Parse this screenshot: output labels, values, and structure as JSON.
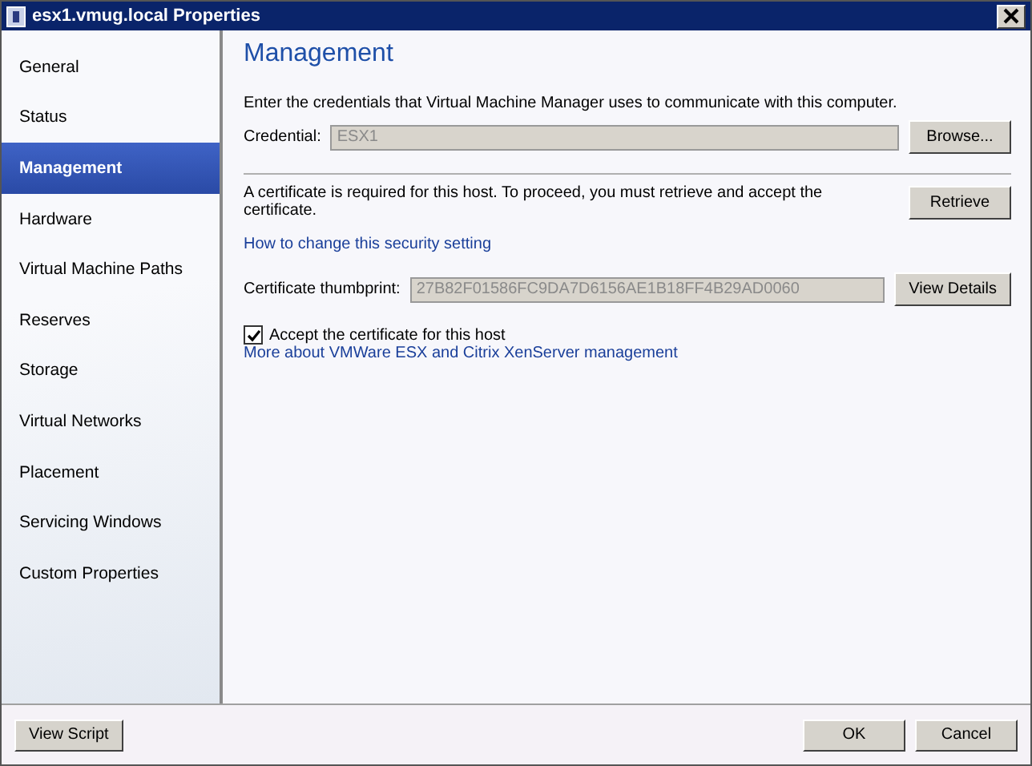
{
  "window": {
    "title": "esx1.vmug.local Properties"
  },
  "sidebar": {
    "items": [
      {
        "label": "General",
        "selected": false
      },
      {
        "label": "Status",
        "selected": false
      },
      {
        "label": "Management",
        "selected": true
      },
      {
        "label": "Hardware",
        "selected": false
      },
      {
        "label": "Virtual Machine Paths",
        "selected": false
      },
      {
        "label": "Reserves",
        "selected": false
      },
      {
        "label": "Storage",
        "selected": false
      },
      {
        "label": "Virtual Networks",
        "selected": false
      },
      {
        "label": "Placement",
        "selected": false
      },
      {
        "label": "Servicing Windows",
        "selected": false
      },
      {
        "label": "Custom Properties",
        "selected": false
      }
    ]
  },
  "content": {
    "heading": "Management",
    "credentials_text": "Enter the credentials that Virtual Machine Manager uses to communicate with this computer.",
    "credential": {
      "label": "Credential:",
      "value": "ESX1",
      "disabled": true
    },
    "browse_button": "Browse...",
    "certificate_text": "A certificate is required for this host. To proceed, you must retrieve and accept the certificate.",
    "retrieve_button": "Retrieve",
    "security_link": "How to change this security setting",
    "thumbprint": {
      "label": "Certificate thumbprint:",
      "value": "27B82F01586FC9DA7D6156AE1B18FF4B29AD0060",
      "disabled": true
    },
    "view_details_button": "View Details",
    "accept_checkbox": {
      "label": "Accept the certificate for this host",
      "checked": true
    },
    "more_link": "More about VMWare ESX and Citrix XenServer management"
  },
  "footer": {
    "left_buttons": [
      "View Script"
    ],
    "right_buttons": [
      "OK",
      "Cancel"
    ]
  }
}
